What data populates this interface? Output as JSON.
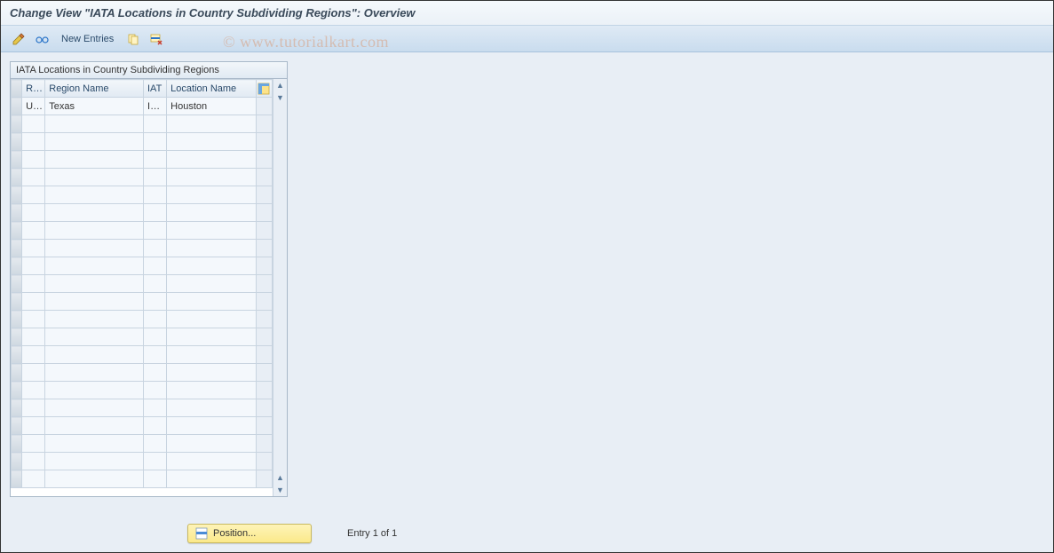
{
  "title": "Change View \"IATA Locations in Country Subdividing Regions\": Overview",
  "toolbar": {
    "new_entries": "New Entries"
  },
  "table": {
    "title": "IATA Locations in Country Subdividing Regions",
    "columns": {
      "reg": "Reg",
      "region_name": "Region Name",
      "iat": "IAT",
      "location_name": "Location Name"
    },
    "rows": [
      {
        "reg": "UTX",
        "region_name": "Texas",
        "iat": "IAH",
        "location_name": "Houston"
      }
    ]
  },
  "footer": {
    "position_label": "Position...",
    "status": "Entry 1 of 1"
  },
  "watermark": "© www.tutorialkart.com"
}
